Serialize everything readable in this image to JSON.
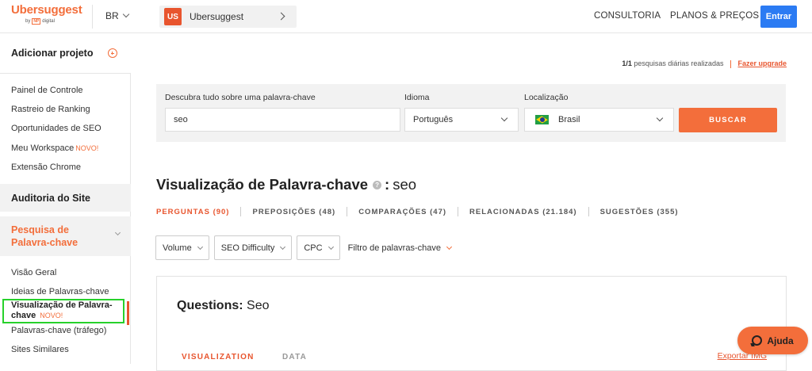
{
  "header": {
    "logo": "Ubersuggest",
    "logo_by": "by",
    "logo_np": "NP",
    "logo_digital": "digital",
    "language": "BR",
    "project_badge": "US",
    "project_name": "Ubersuggest",
    "nav": [
      "CONSULTORIA",
      "PLANOS & PREÇOS"
    ],
    "login_label": "Entrar"
  },
  "sidebar": {
    "add_project": "Adicionar projeto",
    "items": [
      "Painel de Controle",
      "Rastreio de Ranking",
      "Oportunidades de SEO",
      "Meu Workspace",
      "Extensão Chrome"
    ],
    "novo_tag": "NOVO!",
    "site_audit": "Auditoria do Site",
    "keyword_research": "Pesquisa de Palavra-chave",
    "sub_items": [
      "Visão Geral",
      "Ideias de Palavras-chave",
      "Visualização de Palavra-chave",
      "Palavras-chave (tráfego)",
      "Sites Similares"
    ]
  },
  "quota": {
    "count": "1/1",
    "text": "pesquisas diárias realizadas",
    "upgrade": "Fazer upgrade"
  },
  "search": {
    "keyword_label": "Descubra tudo sobre uma palavra-chave",
    "keyword_value": "seo",
    "language_label": "Idioma",
    "language_value": "Português",
    "location_label": "Localização",
    "location_value": "Brasil",
    "button": "BUSCAR"
  },
  "main": {
    "title": "Visualização de Palavra-chave",
    "title_colon": ":",
    "keyword": "seo",
    "tabs": [
      {
        "label": "PERGUNTAS (90)",
        "active": true
      },
      {
        "label": "PREPOSIÇÕES (48)",
        "active": false
      },
      {
        "label": "COMPARAÇÕES (47)",
        "active": false
      },
      {
        "label": "RELACIONADAS (21.184)",
        "active": false
      },
      {
        "label": "SUGESTÕES (355)",
        "active": false
      }
    ],
    "filters": [
      "Volume",
      "SEO Difficulty",
      "CPC"
    ],
    "filter_link": "Filtro de palavras-chave"
  },
  "card": {
    "title_bold": "Questions:",
    "title_kw": "Seo",
    "tab_visualization": "VISUALIZATION",
    "tab_data": "DATA",
    "export": "Exportar IMG"
  },
  "help": {
    "label": "Ajuda"
  },
  "colors": {
    "accent": "#f36e3b",
    "primary_blue": "#2b7bf3",
    "highlight": "#27d12b"
  }
}
